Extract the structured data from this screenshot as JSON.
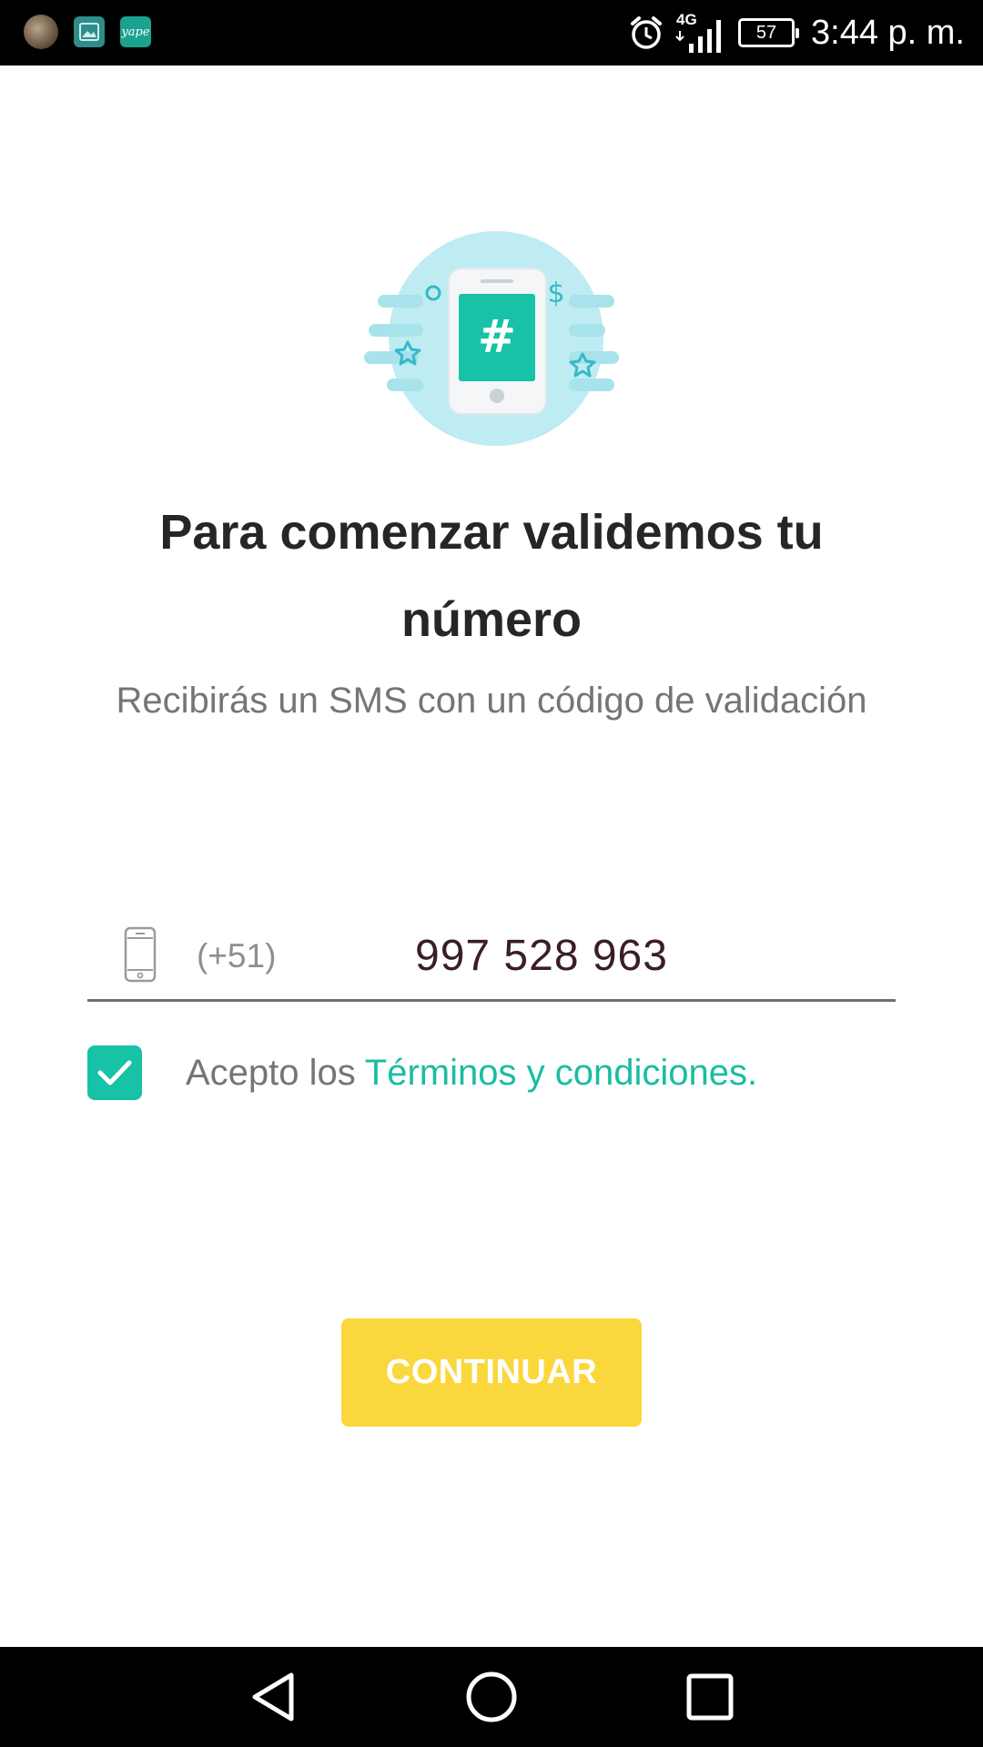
{
  "status_bar": {
    "notifications": [
      "avatar",
      "gallery-icon",
      "yape-icon"
    ],
    "yape_label": "yape",
    "network": "4G",
    "battery": "57",
    "time": "3:44 p. m."
  },
  "main": {
    "headline": "Para comenzar validemos tu número",
    "subtitle": "Recibirás un SMS con un código de validación",
    "phone": {
      "country_code": "(+51)",
      "value": "997 528 963"
    },
    "terms": {
      "checked": true,
      "prefix": "Acepto los",
      "link": "Términos y condiciones."
    },
    "continue_label": "CONTINUAR"
  },
  "colors": {
    "accent": "#17c2a6",
    "button": "#fad73c",
    "illustration_circle": "#bfecf2",
    "headline": "#262626",
    "muted": "#757575"
  },
  "nav": {
    "icons": [
      "back-icon",
      "home-icon",
      "recents-icon"
    ]
  }
}
